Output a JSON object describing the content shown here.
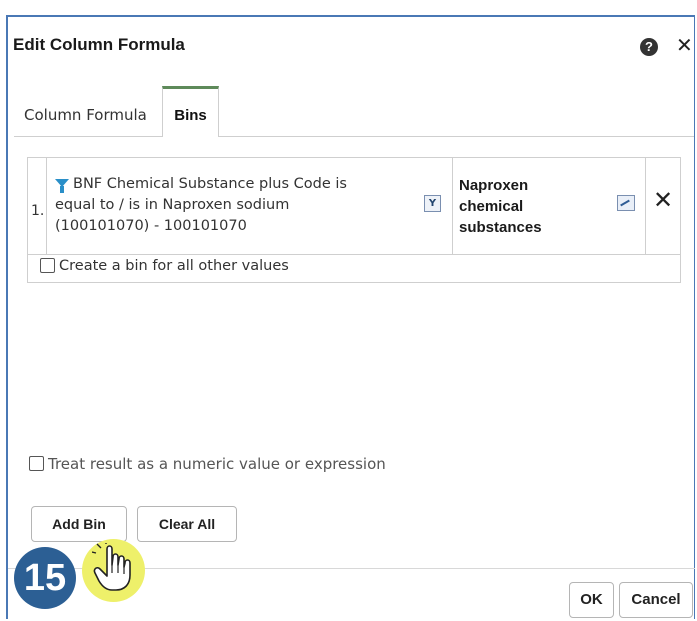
{
  "dialog": {
    "title": "Edit Column Formula",
    "help_glyph": "?",
    "close_glyph": "✕"
  },
  "tabs": [
    {
      "label": "Column Formula",
      "active": false
    },
    {
      "label": "Bins",
      "active": true
    }
  ],
  "bins": [
    {
      "index": "1.",
      "condition": "BNF Chemical Substance plus Code is equal to / is in  Naproxen sodium (100101070) - 100101070",
      "name": "Naproxen chemical substances",
      "filter_icon": "filter-edit-icon",
      "edit_icon": "edit-name-icon",
      "delete_glyph": "✕"
    }
  ],
  "other_values_label": "Create a bin for all other values",
  "numeric_label": "Treat result as a numeric value or expression",
  "buttons": {
    "add_bin": "Add Bin",
    "clear_all": "Clear All",
    "ok": "OK",
    "cancel": "Cancel"
  },
  "tutorial": {
    "step_number": "15",
    "pointer_icon": "hand-pointer-icon",
    "highlight_color": "#eef06a",
    "badge_color": "#2c5f94"
  },
  "colors": {
    "dialog_border": "#4a78b5",
    "active_tab_accent": "#5e8a5a",
    "funnel": "#2a8fc8"
  }
}
